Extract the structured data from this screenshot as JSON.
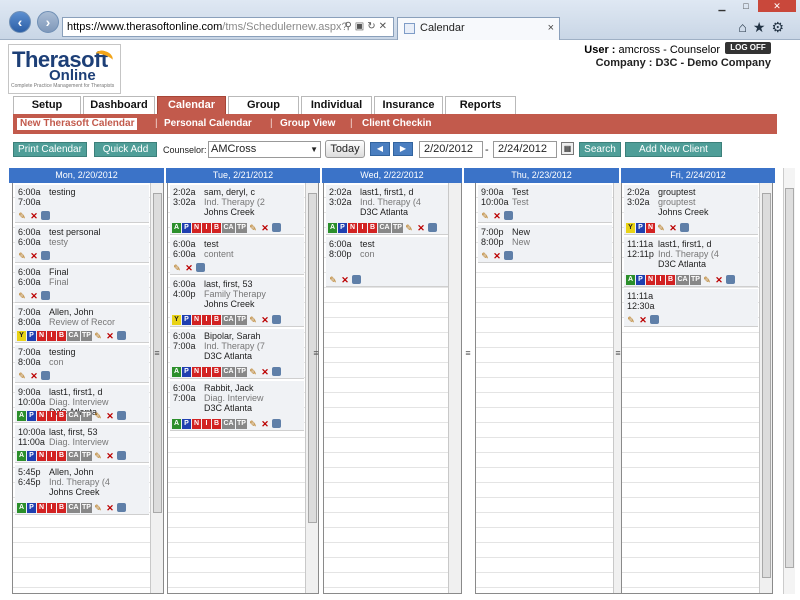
{
  "browser": {
    "url_domain": "https://www.therasoftonline.com",
    "url_path": "/tms/Schedulernew.aspx?",
    "tab_title": "Calendar",
    "tab_close": "×"
  },
  "header": {
    "logo_line1": "Therasoft",
    "logo_line2": "Online",
    "logo_tagline": "Complete Practice Management for Therapists",
    "user_label": "User : ",
    "user_value": "amcross - Counselor",
    "company_label": "Company : ",
    "company_value": "D3C - Demo Company",
    "logoff": "LOG OFF"
  },
  "main_tabs": [
    "Setup",
    "Dashboard",
    "Calendar",
    "Group",
    "Individual",
    "Insurance",
    "Reports"
  ],
  "active_tab": "Calendar",
  "sub_nav": [
    "New Therasoft Calendar",
    "Personal Calendar",
    "Group View",
    "Client Checkin"
  ],
  "sub_nav_sep": "|",
  "toolbar": {
    "print": "Print Calendar",
    "quick_add": "Quick Add",
    "counselor_label": "Counselor:",
    "counselor_value": "AMCross",
    "today": "Today",
    "prev": "◀",
    "next": "▶",
    "start_date": "2/20/2012",
    "dash": "-",
    "end_date": "2/24/2012",
    "search": "Search",
    "add_client": "Add New Client"
  },
  "days": [
    {
      "header": "Mon, 2/20/2012",
      "appts": [
        {
          "t1": "6:00a",
          "t2": "7:00a",
          "l1": "testing",
          "l2": "",
          "l3": "",
          "badges": ""
        },
        {
          "t1": "6:00a",
          "t2": "6:00a",
          "l1": "test personal",
          "l2": "testy",
          "l3": "",
          "badges": ""
        },
        {
          "t1": "6:00a",
          "t2": "6:00a",
          "l1": "Final",
          "l2": "Final",
          "l3": "",
          "badges": ""
        },
        {
          "t1": "7:00a",
          "t2": "8:00a",
          "l1": "Allen, John",
          "l2": "Review of Recor",
          "l3": "",
          "badges": "Y P N I B CA TP"
        },
        {
          "t1": "7:00a",
          "t2": "8:00a",
          "l1": "testing",
          "l2": "con",
          "l3": "",
          "badges": ""
        },
        {
          "t1": "9:00a",
          "t2": "10:00a",
          "l1": "last1, first1, d",
          "l2": "Diag. Interview",
          "l3": "D3C Atlanta",
          "badges": "A P N I B CA TP"
        },
        {
          "t1": "10:00a",
          "t2": "11:00a",
          "l1": "last, first, 53",
          "l2": "Diag. Interview",
          "l3": "",
          "badges": "A P N I B CA TP"
        },
        {
          "t1": "5:45p",
          "t2": "6:45p",
          "l1": "Allen, John",
          "l2": "Ind. Therapy (4",
          "l3": "Johns Creek",
          "badges": "A P N I B CA TP"
        }
      ]
    },
    {
      "header": "Tue, 2/21/2012",
      "appts": [
        {
          "t1": "2:02a",
          "t2": "3:02a",
          "l1": "sam, deryl, c",
          "l2": "Ind. Therapy (2",
          "l3": "Johns Creek",
          "badges": "A P N I B CA TP"
        },
        {
          "t1": "6:00a",
          "t2": "6:00a",
          "l1": "test",
          "l2": "content",
          "l3": "",
          "badges": ""
        },
        {
          "t1": "6:00a",
          "t2": "4:00p",
          "l1": "last, first, 53",
          "l2": "Family Therapy",
          "l3": "Johns Creek",
          "badges": "Y P N I B CA TP"
        },
        {
          "t1": "6:00a",
          "t2": "7:00a",
          "l1": "Bipolar, Sarah",
          "l2": "Ind. Therapy (7",
          "l3": "D3C Atlanta",
          "badges": "A P N I B CA TP"
        },
        {
          "t1": "6:00a",
          "t2": "7:00a",
          "l1": "Rabbit, Jack",
          "l2": "Diag. Interview",
          "l3": "D3C Atlanta",
          "badges": "A P N I B CA TP"
        }
      ]
    },
    {
      "header": "Wed, 2/22/2012",
      "appts": [
        {
          "t1": "2:02a",
          "t2": "3:02a",
          "l1": "last1, first1, d",
          "l2": "Ind. Therapy (4",
          "l3": "D3C Atlanta",
          "badges": "A P N I B CA TP"
        },
        {
          "t1": "6:00a",
          "t2": "8:00p",
          "l1": "test",
          "l2": "con",
          "l3": "",
          "badges": ""
        }
      ]
    },
    {
      "header": "Thu, 2/23/2012",
      "appts": [
        {
          "t1": "9:00a",
          "t2": "10:00a",
          "l1": "Test",
          "l2": "Test",
          "l3": "",
          "badges": ""
        },
        {
          "t1": "7:00p",
          "t2": "8:00p",
          "l1": "New",
          "l2": "New",
          "l3": "",
          "badges": ""
        }
      ]
    },
    {
      "header": "Fri, 2/24/2012",
      "appts": [
        {
          "t1": "2:02a",
          "t2": "3:02a",
          "l1": "grouptest",
          "l2": "grouptest",
          "l3": "Johns Creek",
          "badges": "Y P N"
        },
        {
          "t1": "11:11a",
          "t2": "12:11p",
          "l1": "last1, first1, d",
          "l2": "Ind. Therapy (4",
          "l3": "D3C Atlanta",
          "badges": "A P N I B CA TP"
        },
        {
          "t1": "11:11a",
          "t2": "12:30a",
          "l1": "",
          "l2": "",
          "l3": "",
          "badges": ""
        }
      ]
    }
  ],
  "colors": {
    "accent_red": "#c25a4c",
    "teal_button": "#4f9e98",
    "day_header_blue": "#3b73c8",
    "badge_green": "#2b8f2b",
    "badge_yellow": "#e9d316",
    "badge_blue": "#1f3fb0",
    "badge_red": "#d22222"
  },
  "icons": [
    "back-icon",
    "forward-icon",
    "search-icon",
    "lock-icon",
    "refresh-icon",
    "close-icon",
    "home-icon",
    "star-icon",
    "gear-icon",
    "pencil-icon",
    "delete-icon",
    "save-icon",
    "calendar-icon"
  ]
}
